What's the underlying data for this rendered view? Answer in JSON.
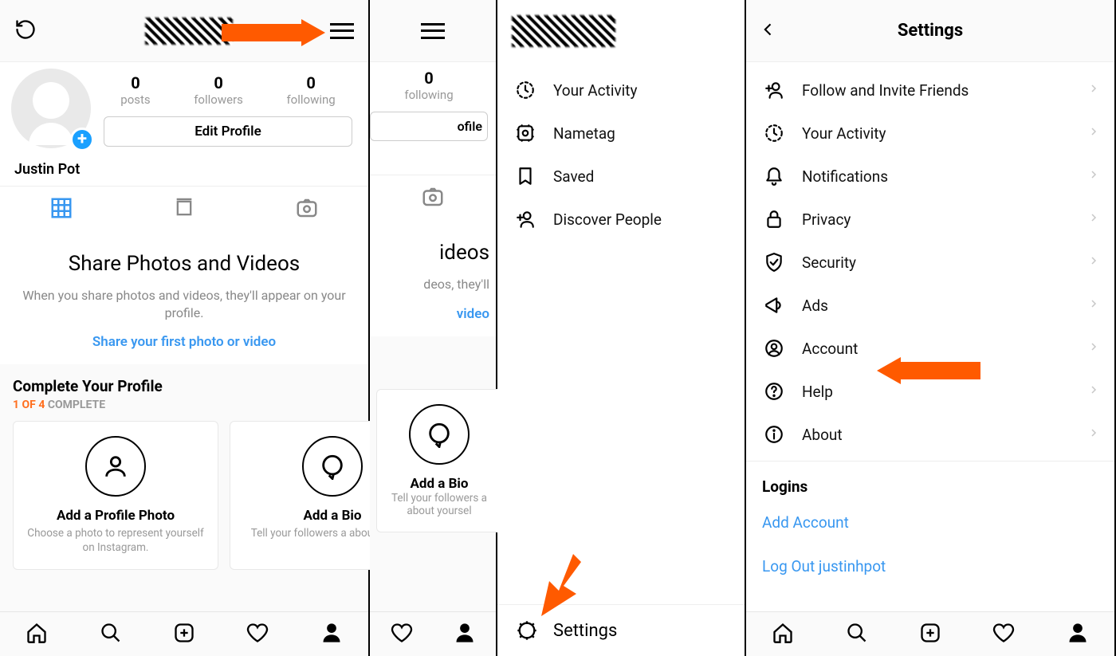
{
  "panel1": {
    "stats": {
      "posts": {
        "count": "0",
        "label": "posts"
      },
      "followers": {
        "count": "0",
        "label": "followers"
      },
      "following": {
        "count": "0",
        "label": "following"
      }
    },
    "edit_label": "Edit Profile",
    "display_name": "Justin Pot",
    "empty": {
      "heading": "Share Photos and Videos",
      "body": "When you share photos and videos, they'll appear on your profile.",
      "cta": "Share your first photo or video"
    },
    "complete": {
      "heading": "Complete Your Profile",
      "progress_bold": "1 OF 4",
      "progress_rest": " COMPLETE",
      "cards": [
        {
          "title": "Add a Profile Photo",
          "body": "Choose a photo to represent yourself on Instagram.",
          "icon": "user"
        },
        {
          "title": "Add a Bio",
          "body": "Tell your followers a about yoursel",
          "icon": "comment"
        }
      ]
    }
  },
  "panel2": {
    "stat": {
      "count": "0",
      "label": "following"
    },
    "edit_fragment": "ofile",
    "empty": {
      "heading_fragment": "ideos",
      "body_fragment": "deos, they'll",
      "cta_fragment": "video"
    },
    "card": {
      "title": "Add a Bio",
      "body": "Tell your followers a about yoursel"
    }
  },
  "panel3": {
    "items": [
      {
        "icon": "activity",
        "label": "Your Activity"
      },
      {
        "icon": "nametag",
        "label": "Nametag"
      },
      {
        "icon": "saved",
        "label": "Saved"
      },
      {
        "icon": "discover",
        "label": "Discover People"
      }
    ],
    "settings_label": "Settings"
  },
  "panel4": {
    "title": "Settings",
    "items": [
      {
        "icon": "invite",
        "label": "Follow and Invite Friends"
      },
      {
        "icon": "activity",
        "label": "Your Activity"
      },
      {
        "icon": "notifications",
        "label": "Notifications"
      },
      {
        "icon": "privacy",
        "label": "Privacy"
      },
      {
        "icon": "security",
        "label": "Security"
      },
      {
        "icon": "ads",
        "label": "Ads"
      },
      {
        "icon": "account",
        "label": "Account"
      },
      {
        "icon": "help",
        "label": "Help"
      },
      {
        "icon": "about",
        "label": "About"
      }
    ],
    "logins_header": "Logins",
    "add_account": "Add Account",
    "logout": "Log Out justinhpot"
  },
  "arrows": {
    "color": "#ff5a00"
  }
}
